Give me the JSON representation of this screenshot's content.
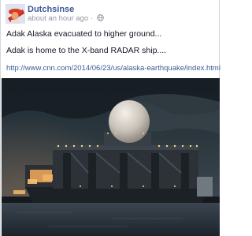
{
  "post": {
    "author": "Dutchsinse",
    "timestamp": "about an hour ago",
    "lines": [
      "Adak Alaska evacuated to higher ground...",
      "Adak is home to the X-band RADAR ship...."
    ],
    "link": "http://www.cnn.com/2014/06/23/us/alaska-earthquake/index.html"
  },
  "icons": {
    "privacy": "globe-icon"
  }
}
